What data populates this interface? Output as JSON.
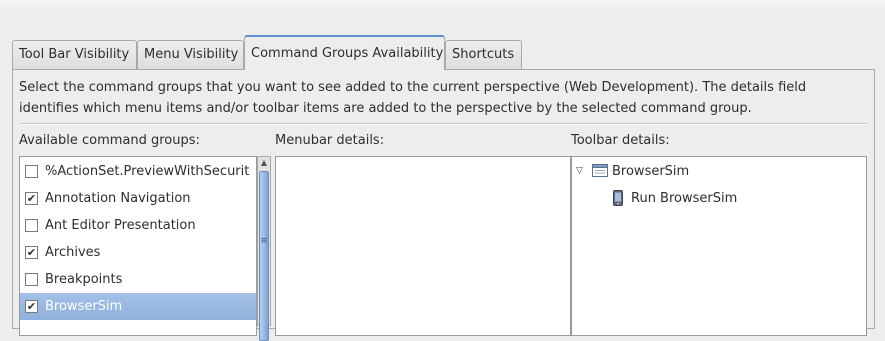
{
  "tabs": [
    {
      "label": "Tool Bar Visibility",
      "active": false
    },
    {
      "label": "Menu Visibility",
      "active": false
    },
    {
      "label": "Command Groups Availability",
      "active": true
    },
    {
      "label": "Shortcuts",
      "active": false
    }
  ],
  "description": "Select the command groups that you want to see added to the current perspective (Web Development).  The details field identifies which menu items and/or toolbar items are added to the perspective by the selected command group.",
  "available": {
    "label": "Available command groups:",
    "items": [
      {
        "label": "%ActionSet.PreviewWithSecurit",
        "checked": false,
        "selected": false
      },
      {
        "label": "Annotation Navigation",
        "checked": true,
        "selected": false
      },
      {
        "label": "Ant Editor Presentation",
        "checked": false,
        "selected": false
      },
      {
        "label": "Archives",
        "checked": true,
        "selected": false
      },
      {
        "label": "Breakpoints",
        "checked": false,
        "selected": false
      },
      {
        "label": "BrowserSim",
        "checked": true,
        "selected": true
      }
    ]
  },
  "menubar": {
    "label": "Menubar details:"
  },
  "toolbar": {
    "label": "Toolbar details:",
    "tree": {
      "label": "BrowserSim",
      "icon": "toolbar-group-icon",
      "expanded": true,
      "children": [
        {
          "label": "Run BrowserSim",
          "icon": "phone-icon"
        }
      ]
    }
  },
  "glyphs": {
    "check": "✔",
    "expanded": "▽",
    "scroll_up": "▲",
    "grip": "≡"
  },
  "colors": {
    "selection": "#8fb1dc",
    "active_tab_accent": "#5a8fd0"
  }
}
